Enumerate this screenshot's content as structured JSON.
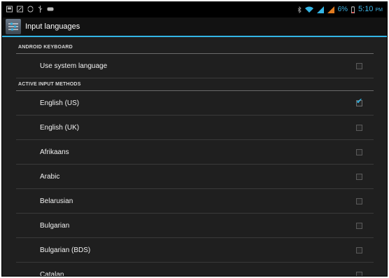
{
  "status_bar": {
    "left_icons": [
      "notification-icon",
      "screenshot-icon",
      "sync-icon",
      "usb-icon",
      "gamepad-icon"
    ],
    "battery_text": "6%",
    "time": "5:10",
    "time_suffix": "PM"
  },
  "action_bar": {
    "title": "Input languages",
    "icon": "settings-sliders-icon"
  },
  "sections": [
    {
      "header": "ANDROID KEYBOARD",
      "items": [
        {
          "label": "Use system language",
          "checked": false
        }
      ]
    },
    {
      "header": "ACTIVE INPUT METHODS",
      "items": [
        {
          "label": "English (US)",
          "checked": true
        },
        {
          "label": "English (UK)",
          "checked": false
        },
        {
          "label": "Afrikaans",
          "checked": false
        },
        {
          "label": "Arabic",
          "checked": false
        },
        {
          "label": "Belarusian",
          "checked": false
        },
        {
          "label": "Bulgarian",
          "checked": false
        },
        {
          "label": "Bulgarian (BDS)",
          "checked": false
        },
        {
          "label": "Catalan",
          "checked": false
        }
      ]
    }
  ],
  "colors": {
    "accent": "#33b5e5",
    "background": "#1f1f1f"
  }
}
